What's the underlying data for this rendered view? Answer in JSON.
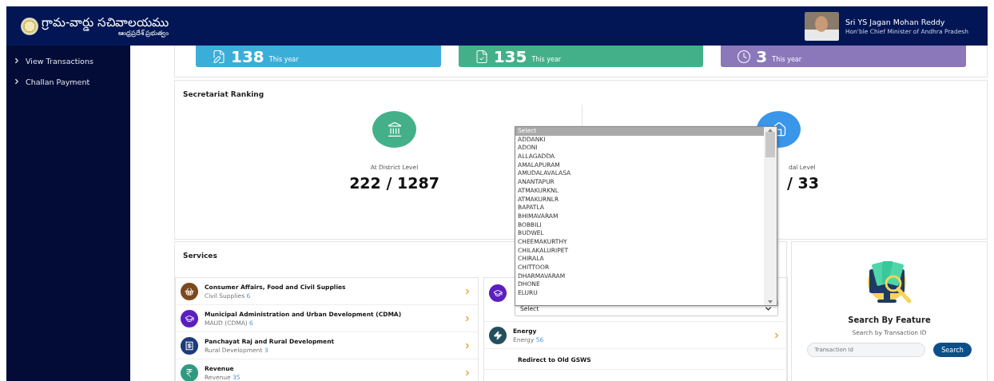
{
  "header": {
    "logo_title": "గ్రామ-వార్డు సచివాలయము",
    "logo_subtitle": "ఆంధ్రప్రదేశ్ ప్రభుత్వం",
    "user_name": "Sri YS Jagan Mohan Reddy",
    "user_role": "Hon'ble Chief Minister of Andhra Pradesh"
  },
  "sidebar": {
    "items": [
      {
        "label": "View Transactions"
      },
      {
        "label": "Challan Payment"
      }
    ]
  },
  "stats": [
    {
      "value": "138",
      "caption": "This year",
      "color": "#3aaed8"
    },
    {
      "value": "135",
      "caption": "This year",
      "color": "#43b08a"
    },
    {
      "value": "3",
      "caption": "This year",
      "color": "#8a78bb"
    }
  ],
  "ranking": {
    "title": "Secretariat Ranking",
    "levels": [
      {
        "label": "At District Level",
        "value": "222 / 1287",
        "color": "#43b08a"
      },
      {
        "label": "dal Level",
        "value": "/ 33",
        "color": "#3a96e8"
      }
    ]
  },
  "services": {
    "title": "Services",
    "left": [
      {
        "title": "Consumer Affairs, Food and Civil Supplies",
        "subtitle": "Civil Supplies",
        "count": "6",
        "color": "#7a4a1e"
      },
      {
        "title": "Municipal Administration and Urban Development (CDMA)",
        "subtitle": "MAUD (CDMA)",
        "count": "6",
        "color": "#5b1fc0"
      },
      {
        "title": "Panchayat Raj and Rural Development",
        "subtitle": "Rural Development",
        "count": "3",
        "color": "#1d3a7a"
      },
      {
        "title": "Revenue",
        "subtitle": "Revenue",
        "count": "35",
        "color": "#2f9a80"
      }
    ],
    "right": [
      {
        "kind": "select",
        "color": "#5b1fc0",
        "value": "Select"
      },
      {
        "kind": "link",
        "title": "Energy",
        "subtitle": "Energy",
        "count": "56",
        "color": "#24505e"
      },
      {
        "kind": "plain",
        "title": "Redirect to Old GSWS"
      }
    ]
  },
  "dropdown": {
    "options": [
      {
        "label": "Select",
        "selected": true
      },
      {
        "label": "ADDANKI",
        "selected": false
      },
      {
        "label": "ADONI",
        "selected": false
      },
      {
        "label": "ALLAGADDA",
        "selected": false
      },
      {
        "label": "AMALAPURAM",
        "selected": false
      },
      {
        "label": "AMUDALAVALASA",
        "selected": false
      },
      {
        "label": "ANANTAPUR",
        "selected": false
      },
      {
        "label": "ATMAKURKNL",
        "selected": false
      },
      {
        "label": "ATMAKURNLR",
        "selected": false
      },
      {
        "label": "BAPATLA",
        "selected": false
      },
      {
        "label": "BHIMAVARAM",
        "selected": false
      },
      {
        "label": "BOBBILI",
        "selected": false
      },
      {
        "label": "BUDWEL",
        "selected": false
      },
      {
        "label": "CHEEMAKURTHY",
        "selected": false
      },
      {
        "label": "CHILAKALURIPET",
        "selected": false
      },
      {
        "label": "CHIRALA",
        "selected": false
      },
      {
        "label": "CHITTOOR",
        "selected": false
      },
      {
        "label": "DHARMAVARAM",
        "selected": false
      },
      {
        "label": "DHONE",
        "selected": false
      },
      {
        "label": "ELURU",
        "selected": false
      }
    ]
  },
  "search_panel": {
    "title": "Search By Feature",
    "subtitle": "Search by Transaction ID",
    "placeholder": "Transaction Id",
    "button": "Search"
  }
}
